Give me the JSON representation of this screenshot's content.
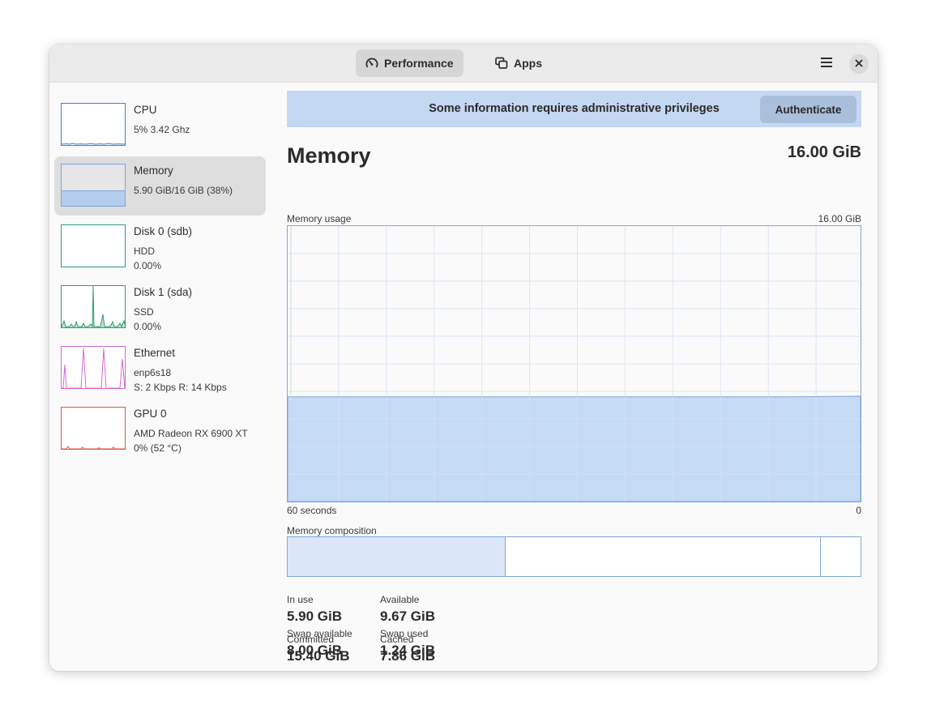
{
  "tabs": [
    {
      "label": "Performance",
      "icon": "speedometer-icon",
      "active": true
    },
    {
      "label": "Apps",
      "icon": "windows-icon",
      "active": false
    }
  ],
  "headerbar": {
    "menu_icon": "hamburger-menu-icon",
    "close_icon": "close-icon"
  },
  "sidebar": {
    "items": [
      {
        "title": "CPU",
        "line1": "5% 3.42 Ghz",
        "line2": "",
        "color": "#3f7ed8"
      },
      {
        "title": "Memory",
        "line1": "5.90 GiB/16 GiB (38%)",
        "line2": "",
        "color": "#7ea6dd",
        "usage_fraction": 0.38
      },
      {
        "title": "Disk 0 (sdb)",
        "line1": "HDD",
        "line2": "0.00%",
        "color": "#2e9d6a"
      },
      {
        "title": "Disk 1 (sda)",
        "line1": "SSD",
        "line2": "0.00%",
        "color": "#2e9d6a"
      },
      {
        "title": "Ethernet",
        "line1": "enp6s18",
        "line2": "S: 2 Kbps R: 14 Kbps",
        "color": "#d26ad2"
      },
      {
        "title": "GPU 0",
        "line1": "AMD Radeon RX 6900 XT",
        "line2": "0% (52 °C)",
        "color": "#e0534a"
      }
    ]
  },
  "banner": {
    "text": "Some information requires administrative privileges",
    "button_label": "Authenticate"
  },
  "main": {
    "title": "Memory",
    "total": "16.00 GiB",
    "graph_label": "Memory usage",
    "graph_max_label": "16.00 GiB",
    "graph_left_label": "60 seconds",
    "graph_right_label": "0",
    "composition_label": "Memory composition",
    "usage_fraction": 0.38,
    "composition": {
      "in_use_fraction": 0.38,
      "cached_fraction": 0.55
    }
  },
  "stats": [
    {
      "label": "In use",
      "value": "5.90 GiB"
    },
    {
      "label": "Available",
      "value": "9.67 GiB"
    },
    {
      "label": "Committed",
      "value": "15.40 GiB"
    },
    {
      "label": "Cached",
      "value": "7.86 GiB"
    },
    {
      "label": "Swap available",
      "value": "8.00 GiB"
    },
    {
      "label": "Swap used",
      "value": "1.24 GiB"
    }
  ],
  "colors": {
    "accent_blue": "#7ea6dd",
    "fill_blue": "#bcd5f3",
    "banner_blue": "#c4d8f2"
  }
}
